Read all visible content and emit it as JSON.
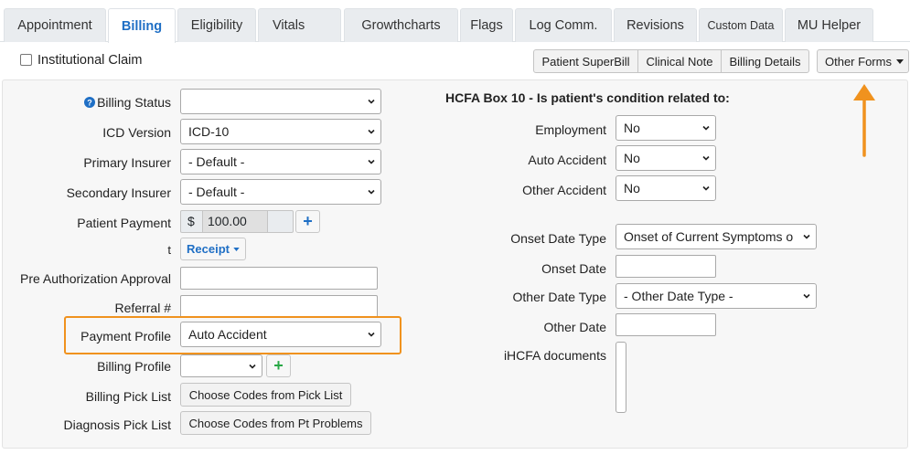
{
  "tabs": [
    {
      "label": "Appointment",
      "active": false
    },
    {
      "label": "Billing",
      "active": true
    },
    {
      "label": "Eligibility",
      "active": false
    },
    {
      "label": "Vitals",
      "active": false
    },
    {
      "label": "Growthcharts",
      "active": false
    },
    {
      "label": "Flags",
      "active": false
    },
    {
      "label": "Log Comm.",
      "active": false
    },
    {
      "label": "Revisions",
      "active": false
    },
    {
      "label": "Custom Data",
      "active": false
    },
    {
      "label": "MU Helper",
      "active": false
    }
  ],
  "toolbar": {
    "institutional_claim_label": "Institutional Claim",
    "institutional_claim_checked": false,
    "patient_superbill": "Patient SuperBill",
    "clinical_note": "Clinical Note",
    "billing_details": "Billing Details",
    "other_forms": "Other Forms"
  },
  "left_form": {
    "billing_status": {
      "label": "Billing Status",
      "value": ""
    },
    "icd_version": {
      "label": "ICD Version",
      "value": "ICD-10"
    },
    "primary_insurer": {
      "label": "Primary Insurer",
      "value": "- Default -"
    },
    "secondary_insurer": {
      "label": "Secondary Insurer",
      "value": "- Default -"
    },
    "patient_payment": {
      "label": "Patient Payment",
      "currency": "$",
      "value": "100.00"
    },
    "receipt_label": "t",
    "receipt_button": "Receipt",
    "pre_authorization": {
      "label": "Pre Authorization Approval",
      "value": ""
    },
    "referral": {
      "label": "Referral #",
      "value": ""
    },
    "payment_profile": {
      "label": "Payment Profile",
      "value": "Auto Accident"
    },
    "billing_profile": {
      "label": "Billing Profile",
      "value": ""
    },
    "billing_pick_list": {
      "label": "Billing Pick List",
      "button": "Choose Codes from Pick List"
    },
    "diagnosis_pick_list": {
      "label": "Diagnosis Pick List",
      "button": "Choose Codes from Pt Problems"
    }
  },
  "right_form": {
    "heading": "HCFA Box 10 - Is patient's condition related to:",
    "employment": {
      "label": "Employment",
      "value": "No"
    },
    "auto_accident": {
      "label": "Auto Accident",
      "value": "No"
    },
    "other_accident": {
      "label": "Other Accident",
      "value": "No"
    },
    "onset_date_type": {
      "label": "Onset Date Type",
      "value": "Onset of Current Symptoms o"
    },
    "onset_date": {
      "label": "Onset Date",
      "value": ""
    },
    "other_date_type": {
      "label": "Other Date Type",
      "value": "- Other Date Type -"
    },
    "other_date": {
      "label": "Other Date",
      "value": ""
    },
    "ihcfa_documents": {
      "label": "iHCFA documents"
    }
  },
  "colors": {
    "accent": "#1f6fc5",
    "highlight": "#f0921e",
    "add_green": "#28a745"
  }
}
